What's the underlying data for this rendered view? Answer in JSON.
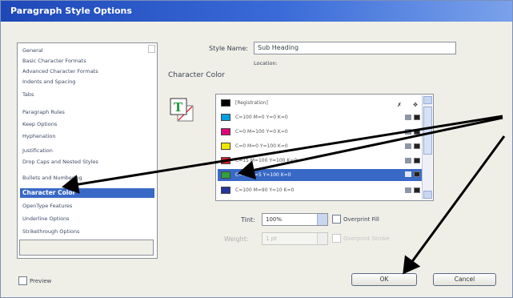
{
  "window": {
    "title": "Paragraph Style Options"
  },
  "categories": [
    "General",
    "Basic Character Formats",
    "Advanced Character Formats",
    "Indents and Spacing",
    "Tabs",
    "Paragraph Rules",
    "Keep Options",
    "Hyphenation",
    "Justification",
    "Drop Caps and Nested Styles",
    "Bullets and Numbering",
    "Character Color",
    "OpenType Features",
    "Underline Options",
    "Strikethrough Options"
  ],
  "selected_category": "Character Color",
  "style_name": {
    "label": "Style Name:",
    "value": "Sub Heading"
  },
  "location_label": "Location:",
  "section_title": "Character Color",
  "swatches": [
    {
      "name": "[Registration]",
      "color": "#000000"
    },
    {
      "name": "C=100 M=0 Y=0 K=0",
      "color": "#00a0e0"
    },
    {
      "name": "C=0 M=100 Y=0 K=0",
      "color": "#e0007a"
    },
    {
      "name": "C=0 M=0 Y=100 K=0",
      "color": "#f2e600"
    },
    {
      "name": "C=15 M=100 Y=100 K=0",
      "color": "#d2202a"
    },
    {
      "name": "C=75 M=5 Y=100 K=0",
      "color": "#30a040",
      "selected": true
    },
    {
      "name": "C=100 M=90 Y=10 K=0",
      "color": "#23379a"
    }
  ],
  "tint": {
    "label": "Tint:",
    "value": "100%"
  },
  "overprint_fill": "Overprint Fill",
  "weight": {
    "label": "Weight:",
    "value": "1 pt"
  },
  "overprint_stroke": "Overprint Stroke",
  "preview": "Preview",
  "ok": "OK",
  "cancel": "Cancel",
  "colors": {
    "title_bar": "#2a58c8",
    "selection": "#3969c6",
    "dialog_bg": "#f0efe7"
  }
}
